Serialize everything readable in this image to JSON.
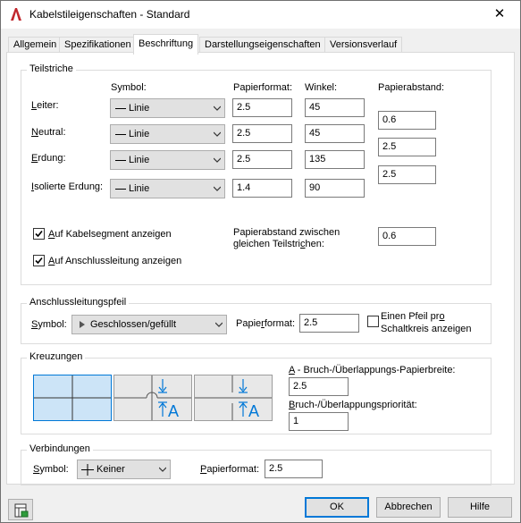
{
  "window": {
    "title": "Kabelstileigenschaften - Standard",
    "close_glyph": "✕"
  },
  "tabs": [
    {
      "label": "Allgemein",
      "active": false
    },
    {
      "label": "Spezifikationen",
      "active": false
    },
    {
      "label": "Beschriftung",
      "active": true
    },
    {
      "label": "Darstellungseigenschaften",
      "active": false
    },
    {
      "label": "Versionsverlauf",
      "active": false
    }
  ],
  "teilstriche": {
    "legend": "Teilstriche",
    "headers": {
      "symbol": "Symbol:",
      "papierformat": "Papierformat:",
      "winkel": "Winkel:",
      "papierabstand": "Papierabstand:"
    },
    "rows": [
      {
        "label_pre": "",
        "label_key": "L",
        "label_post": "eiter:",
        "symbol": "Linie",
        "papierformat": "2.5",
        "winkel": "45"
      },
      {
        "label_pre": "",
        "label_key": "N",
        "label_post": "eutral:",
        "symbol": "Linie",
        "papierformat": "2.5",
        "winkel": "45"
      },
      {
        "label_pre": "",
        "label_key": "E",
        "label_post": "rdung:",
        "symbol": "Linie",
        "papierformat": "2.5",
        "winkel": "135"
      },
      {
        "label_pre": "",
        "label_key": "I",
        "label_post": "solierte Erdung:",
        "symbol": "Linie",
        "papierformat": "1.4",
        "winkel": "90"
      }
    ],
    "papierabstand": [
      "0.6",
      "2.5",
      "2.5"
    ],
    "check_kabelsegment": {
      "label_key": "A",
      "label_post": "uf Kabelsegment anzeigen",
      "checked": true
    },
    "check_anschluss": {
      "label_key": "A",
      "label_post": "uf Anschlussleitung anzeigen",
      "checked": true
    },
    "abstand_zwischen_label_1": "Papierabstand zwischen",
    "abstand_zwischen_label_2_pre": "gleichen Teilstri",
    "abstand_zwischen_label_2_key": "c",
    "abstand_zwischen_label_2_post": "hen:",
    "abstand_zwischen_value": "0.6"
  },
  "anschluss": {
    "legend": "Anschlussleitungspfeil",
    "symbol_label_key": "S",
    "symbol_label_post": "ymbol:",
    "symbol_value": "Geschlossen/gefüllt",
    "papierformat_label_pre": "Papie",
    "papierformat_label_key": "r",
    "papierformat_label_post": "format:",
    "papierformat_value": "2.5",
    "pfeil_label_1_pre": "Einen Pfeil pr",
    "pfeil_label_1_key": "o",
    "pfeil_label_2": "Schaltkreis anzeigen",
    "pfeil_checked": false
  },
  "kreuzungen": {
    "legend": "Kreuzungen",
    "bruch_label_key": "A",
    "bruch_label_post": " - Bruch-/Überlappungs-Papierbreite:",
    "bruch_value": "2.5",
    "prio_label_key": "B",
    "prio_label_post": "ruch-/Überlappungspriorität:",
    "prio_value": "1",
    "preview_letter": "A"
  },
  "verbindungen": {
    "legend": "Verbindungen",
    "symbol_label_key": "S",
    "symbol_label_post": "ymbol:",
    "symbol_value": "Keiner",
    "papierformat_label_key": "P",
    "papierformat_label_post": "apierformat:",
    "papierformat_value": "2.5"
  },
  "buttons": {
    "ok": "OK",
    "abbrechen": "Abbrechen",
    "hilfe": "Hilfe"
  },
  "colors": {
    "accent": "#0078d7",
    "app_icon": "#c1272d",
    "preview_fill": "#cce4f7"
  }
}
